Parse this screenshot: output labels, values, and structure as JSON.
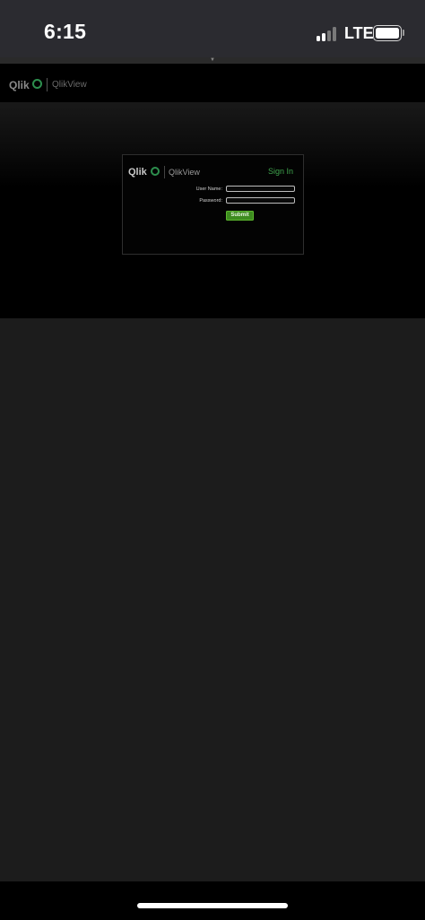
{
  "status_bar": {
    "time": "6:15",
    "network": "LTE",
    "signal_icon": "cellular-signal-icon",
    "battery_icon": "battery-icon"
  },
  "header": {
    "logo_text": "Qlik",
    "product": "QlikView"
  },
  "login": {
    "logo_text": "Qlik",
    "product": "QlikView",
    "title": "Sign In",
    "username_label": "User Name:",
    "username_value": "",
    "password_label": "Password:",
    "password_value": "",
    "submit_label": "Submit"
  },
  "colors": {
    "brand_green": "#3fa34d",
    "submit_green": "#3d8b1f",
    "background": "#1c1c1c"
  }
}
